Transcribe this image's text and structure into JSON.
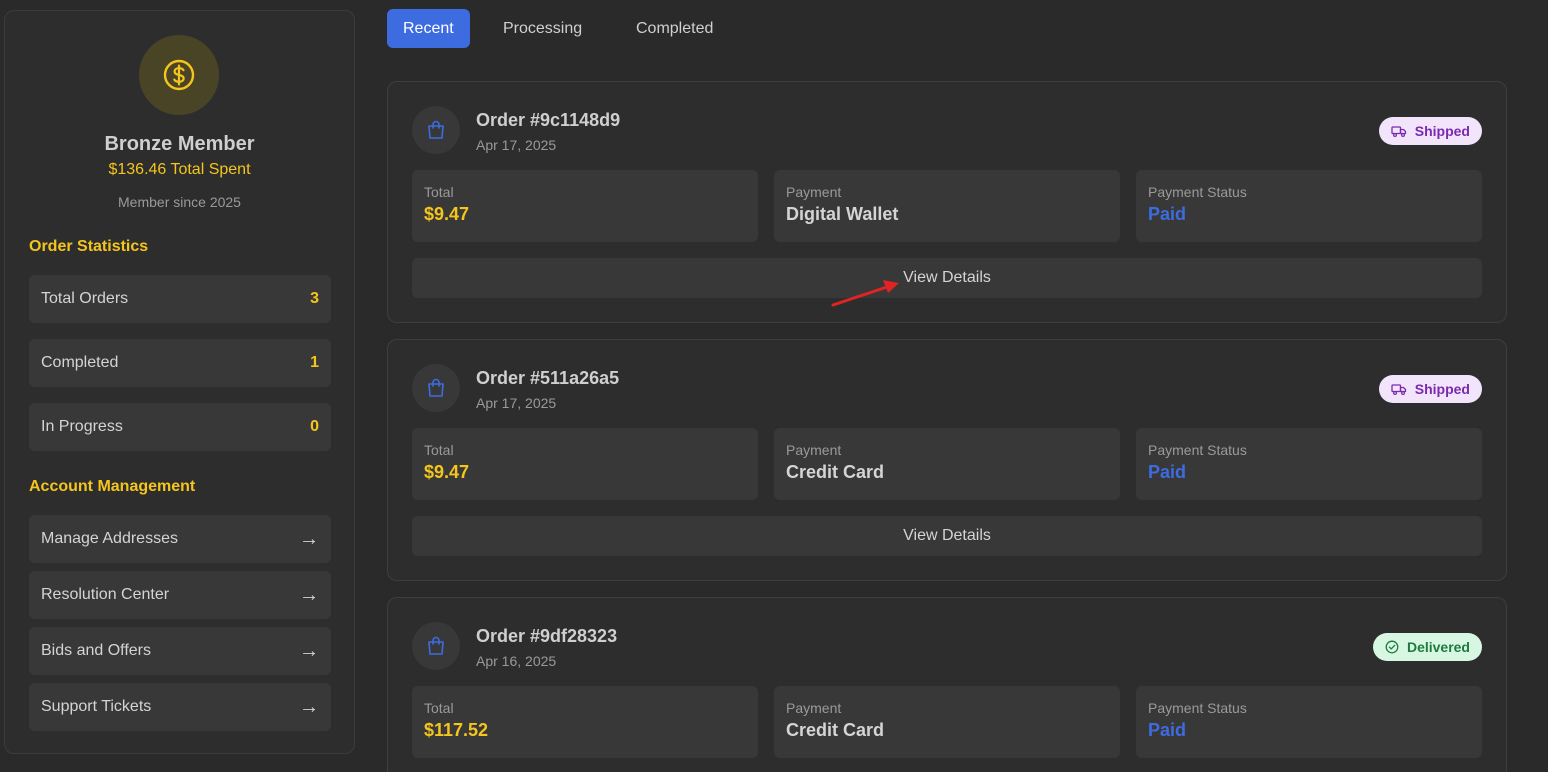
{
  "sidebar": {
    "member_title": "Bronze Member",
    "total_spent": "$136.46 Total Spent",
    "member_since": "Member since 2025",
    "stats_title": "Order Statistics",
    "stats": [
      {
        "label": "Total Orders",
        "value": "3"
      },
      {
        "label": "Completed",
        "value": "1"
      },
      {
        "label": "In Progress",
        "value": "0"
      }
    ],
    "account_title": "Account Management",
    "menu": [
      {
        "label": "Manage Addresses",
        "arrow": "→"
      },
      {
        "label": "Resolution Center",
        "arrow": "→"
      },
      {
        "label": "Bids and Offers",
        "arrow": "→"
      },
      {
        "label": "Support Tickets",
        "arrow": "→"
      }
    ]
  },
  "tabs": [
    {
      "label": "Recent",
      "active": true
    },
    {
      "label": "Processing",
      "active": false
    },
    {
      "label": "Completed",
      "active": false
    }
  ],
  "labels": {
    "total": "Total",
    "payment": "Payment",
    "payment_status": "Payment Status",
    "view_details": "View Details"
  },
  "orders": [
    {
      "id": "Order #9c1148d9",
      "date": "Apr 17, 2025",
      "status": "Shipped",
      "total": "$9.47",
      "payment": "Digital Wallet",
      "payment_status": "Paid"
    },
    {
      "id": "Order #511a26a5",
      "date": "Apr 17, 2025",
      "status": "Shipped",
      "total": "$9.47",
      "payment": "Credit Card",
      "payment_status": "Paid"
    },
    {
      "id": "Order #9df28323",
      "date": "Apr 16, 2025",
      "status": "Delivered",
      "total": "$117.52",
      "payment": "Credit Card",
      "payment_status": "Paid"
    }
  ],
  "colors": {
    "accent_gold": "#f4c51c",
    "accent_blue": "#3d6ce0",
    "shipped_bg": "#f1e4fb",
    "shipped_fg": "#7a2ab0",
    "delivered_bg": "#d8f7e3",
    "delivered_fg": "#1d7b3d",
    "annotation_arrow": "#e02424"
  },
  "icons": {
    "tier": "dollar-coin-icon",
    "order": "shopping-bag-icon",
    "shipped": "truck-icon",
    "delivered": "check-circle-icon",
    "menu_arrow": "arrow-right-icon"
  }
}
